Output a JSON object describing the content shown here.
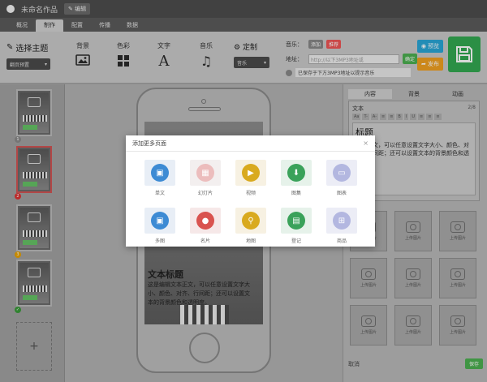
{
  "window": {
    "title": "未命名作品",
    "edit_label": "编辑"
  },
  "tabs": [
    {
      "label": "概况",
      "active": false
    },
    {
      "label": "制作",
      "active": true
    },
    {
      "label": "配置",
      "active": false
    },
    {
      "label": "传播",
      "active": false
    },
    {
      "label": "数据",
      "active": false
    }
  ],
  "toolbar": {
    "theme_label": "选择主题",
    "theme_dropdown": "翻页预置",
    "background_label": "背景",
    "color_label": "色彩",
    "text_label": "文字",
    "text_glyph": "A",
    "music_label": "音乐",
    "custom_label": "定制",
    "custom_dropdown": "音乐",
    "music_field_label": "音乐：",
    "music_tag_1": "添加",
    "music_tag_2": "推荐",
    "address_label": "地址：",
    "address_value": "http://以下3MP3地址或",
    "address_go": "确定",
    "note_text": "已保存于下方3MP3地址以提示音乐",
    "preview_label": "预览",
    "publish_label": "发布"
  },
  "pages": [
    {
      "number": "1",
      "badge_color": "#8a8a8a"
    },
    {
      "number": "2",
      "badge_color": "#d33"
    },
    {
      "number": "3",
      "badge_color": "#e8a200"
    },
    {
      "number": "✓",
      "badge_color": "#3a9a3a"
    }
  ],
  "add_page_glyph": "+",
  "phone_screen": {
    "title": "文本标题",
    "body": "这是编辑文本正文，可以任意设置文字大小、颜色、对齐、行间距；还可以设置文本的背景颜色和透明度。"
  },
  "right_panel": {
    "tabs": [
      {
        "label": "内容",
        "active": true
      },
      {
        "label": "背景",
        "active": false
      },
      {
        "label": "动画",
        "active": false
      }
    ],
    "field_label": "文本",
    "char_count": "2/8",
    "editor_buttons": [
      "Aa",
      "T-",
      "A-",
      "≡",
      "≡",
      "B",
      "I",
      "U",
      "≡",
      "≡",
      "≡"
    ],
    "editor_heading": "标题",
    "editor_text": "文本正文，可以任意设置文字大小、颜色、对齐、行间距；还可以设置文本的背景颜色和透明度。",
    "upload_label": "上传图片",
    "upload_count": 9,
    "bottom_label": "取消",
    "save_label": "保存"
  },
  "modal": {
    "title": "添加更多页面",
    "close_glyph": "×",
    "items": [
      {
        "label": "单文",
        "tile_bg": "#e8eef6",
        "circle": "#3d8bd4",
        "glyph": "▣",
        "disabled": false
      },
      {
        "label": "幻灯片",
        "tile_bg": "#f0eaea",
        "circle": "#e6a8a8",
        "glyph": "▦",
        "disabled": true
      },
      {
        "label": "视频",
        "tile_bg": "#f7f1e2",
        "circle": "#d9aa1f",
        "glyph": "▶",
        "disabled": false
      },
      {
        "label": "图集",
        "tile_bg": "#e6f2ea",
        "circle": "#3aa25a",
        "glyph": "⬇",
        "disabled": false
      },
      {
        "label": "图表",
        "tile_bg": "#e6e8f4",
        "circle": "#9aa0d6",
        "glyph": "▭",
        "disabled": true
      },
      {
        "label": "多图",
        "tile_bg": "#e8eef6",
        "circle": "#3d8bd4",
        "glyph": "▣",
        "disabled": false
      },
      {
        "label": "名片",
        "tile_bg": "#f6e8e8",
        "circle": "#d9534f",
        "glyph": "●",
        "disabled": false
      },
      {
        "label": "地图",
        "tile_bg": "#f7f1e2",
        "circle": "#d9aa1f",
        "glyph": "⚲",
        "disabled": false
      },
      {
        "label": "登记",
        "tile_bg": "#e6f2ea",
        "circle": "#3aa25a",
        "glyph": "▤",
        "disabled": false
      },
      {
        "label": "商品",
        "tile_bg": "#e6e8f4",
        "circle": "#9aa0d6",
        "glyph": "⊞",
        "disabled": true
      }
    ]
  }
}
